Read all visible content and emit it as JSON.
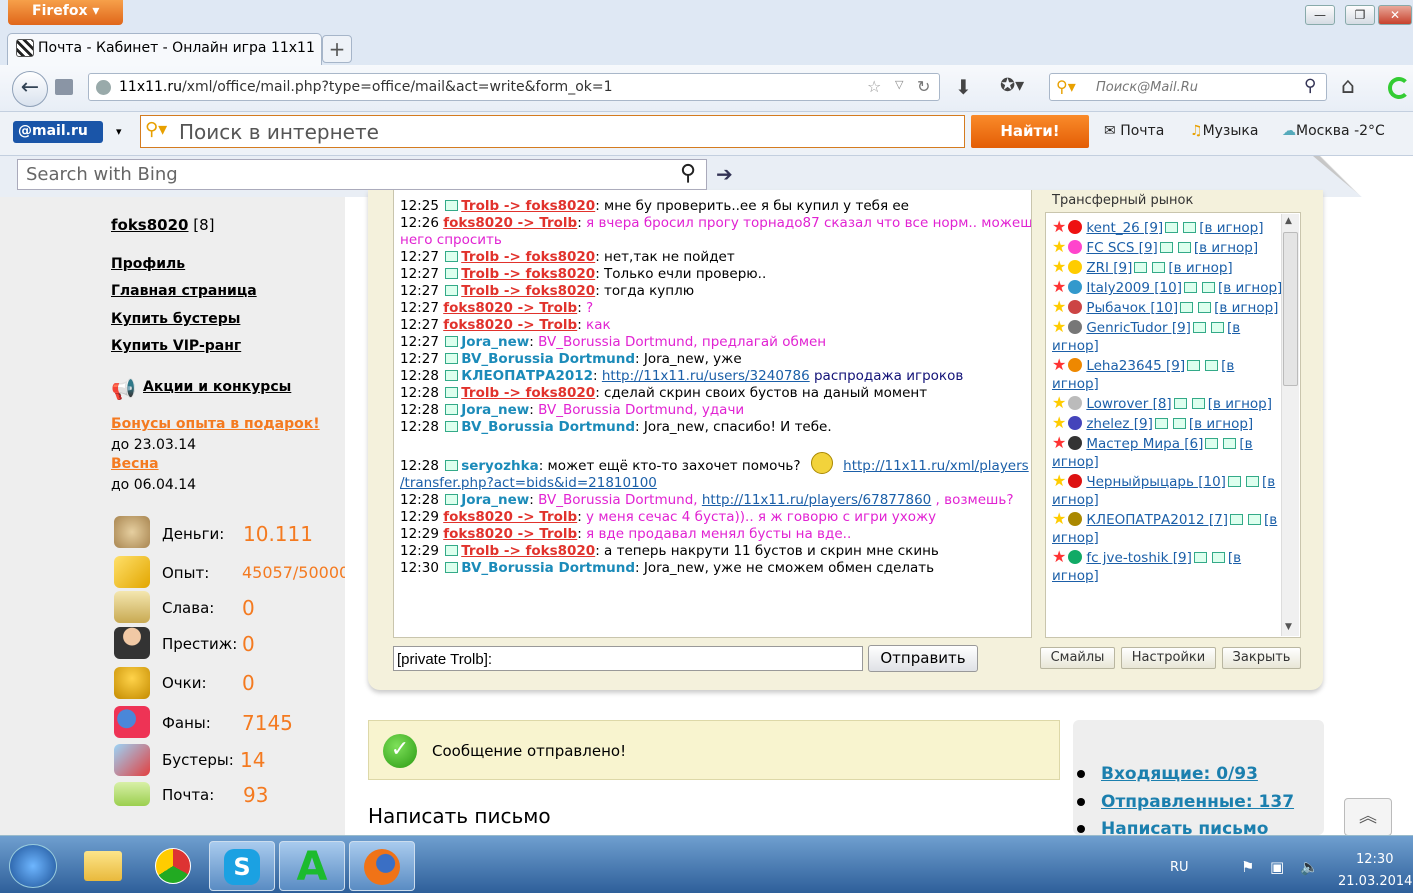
{
  "browser": {
    "menu_button": "Firefox",
    "tab_title": "Почта - Кабинет - Онлайн игра 11x11",
    "new_tab": "+",
    "url_domain": "11x11.ru",
    "url_path": "/xml/office/mail.php?type=office/mail&act=write&form_ok=1",
    "search_placeholder": "Поиск@Mail.Ru"
  },
  "mailru_bar": {
    "logo": "@mail.ru",
    "search_placeholder": "Поиск в интернете",
    "find_button": "Найти!",
    "mail": "Почта",
    "music": "Музыка",
    "weather": "Москва -2°C"
  },
  "bing": {
    "placeholder": "Search with Bing"
  },
  "sidebar": {
    "username": "foks8020",
    "level": "[8]",
    "links": [
      "Профиль",
      "Главная страница",
      "Купить бустеры",
      "Купить VIP-ранг"
    ],
    "promo": "Акции и конкурсы",
    "bonus1": "Бонусы опыта в подарок!",
    "bonus1_date": "до 23.03.14",
    "bonus2": "Весна",
    "bonus2_date": "до 06.04.14",
    "stats": [
      {
        "label": "Деньги:",
        "value": "10.111"
      },
      {
        "label": "Опыт:",
        "value": "45057/50000"
      },
      {
        "label": "Слава:",
        "value": "0"
      },
      {
        "label": "Престиж:",
        "value": "0"
      },
      {
        "label": "Очки:",
        "value": "0"
      },
      {
        "label": "Фаны:",
        "value": "7145"
      },
      {
        "label": "Бустеры:",
        "value": "14"
      },
      {
        "label": "Почта:",
        "value": "93"
      }
    ]
  },
  "chat": {
    "market_label": "Трансферный рынок",
    "input_value": "[private Trolb]:",
    "send_button": "Отправить",
    "smiles_button": "Смайлы",
    "settings_button": "Настройки",
    "close_button": "Закрыть"
  },
  "users": [
    "kent_26 [9]",
    "FC SCS [9]",
    "ZRI [9]",
    "Italy2009 [10]",
    "Рыбачок [10]",
    "GenricTudor [9]",
    "Leha23645 [9]",
    "Lowrover [8]",
    "zhelez [9]",
    "Мастер Мира [6]",
    "Черныйрыцарь [10]",
    "КЛЕОПАТРА2012 [7]",
    "fc jve-toshik [9]"
  ],
  "user_ignore": "[в игнор]",
  "notice": "Сообщение отправлено!",
  "compose_title": "Написать письмо",
  "mail_nav": [
    "Входящие: 0/93",
    "Отправленные: 137",
    "Написать письмо"
  ],
  "taskbar": {
    "lang": "RU",
    "time": "12:30",
    "date": "21.03.2014"
  }
}
